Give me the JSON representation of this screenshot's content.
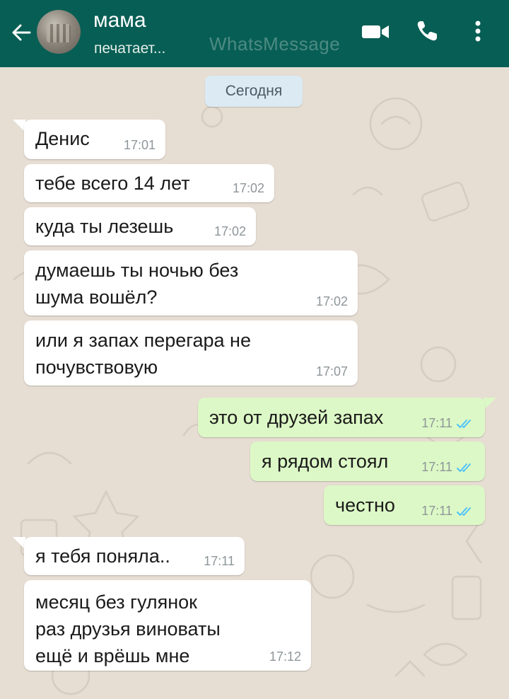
{
  "header": {
    "contact_name": "мама",
    "status": "печатает...",
    "watermark": "WhatsMessage",
    "icons": [
      "back-arrow-icon",
      "video-call-icon",
      "phone-icon",
      "more-vert-icon"
    ],
    "color": "#075e54"
  },
  "chat": {
    "date_label": "Сегодня",
    "messages": [
      {
        "direction": "in",
        "text": "Денис",
        "time": "17:01"
      },
      {
        "direction": "in",
        "text": "тебе всего 14 лет",
        "time": "17:02"
      },
      {
        "direction": "in",
        "text": "куда ты лезешь",
        "time": "17:02"
      },
      {
        "direction": "in",
        "text": "думаешь ты ночью без\nшума вошёл?",
        "time": "17:02"
      },
      {
        "direction": "in",
        "text": "или я запах перегара не\nпочувствовую",
        "time": "17:07"
      },
      {
        "direction": "out",
        "text": "это от друзей запах",
        "time": "17:11",
        "status": "read"
      },
      {
        "direction": "out",
        "text": "я рядом стоял",
        "time": "17:11",
        "status": "read"
      },
      {
        "direction": "out",
        "text": "честно",
        "time": "17:11",
        "status": "read"
      },
      {
        "direction": "in",
        "text": "я тебя поняла..",
        "time": "17:11"
      },
      {
        "direction": "in",
        "text": "месяц без гулянок\nраз друзья виноваты\nещё и врёшь мне",
        "time": "17:12"
      }
    ]
  },
  "colors": {
    "incoming_bubble": "#ffffff",
    "outgoing_bubble": "#dcf8c6",
    "read_tick": "#4fc3f7",
    "background": "#e6ddd3"
  }
}
